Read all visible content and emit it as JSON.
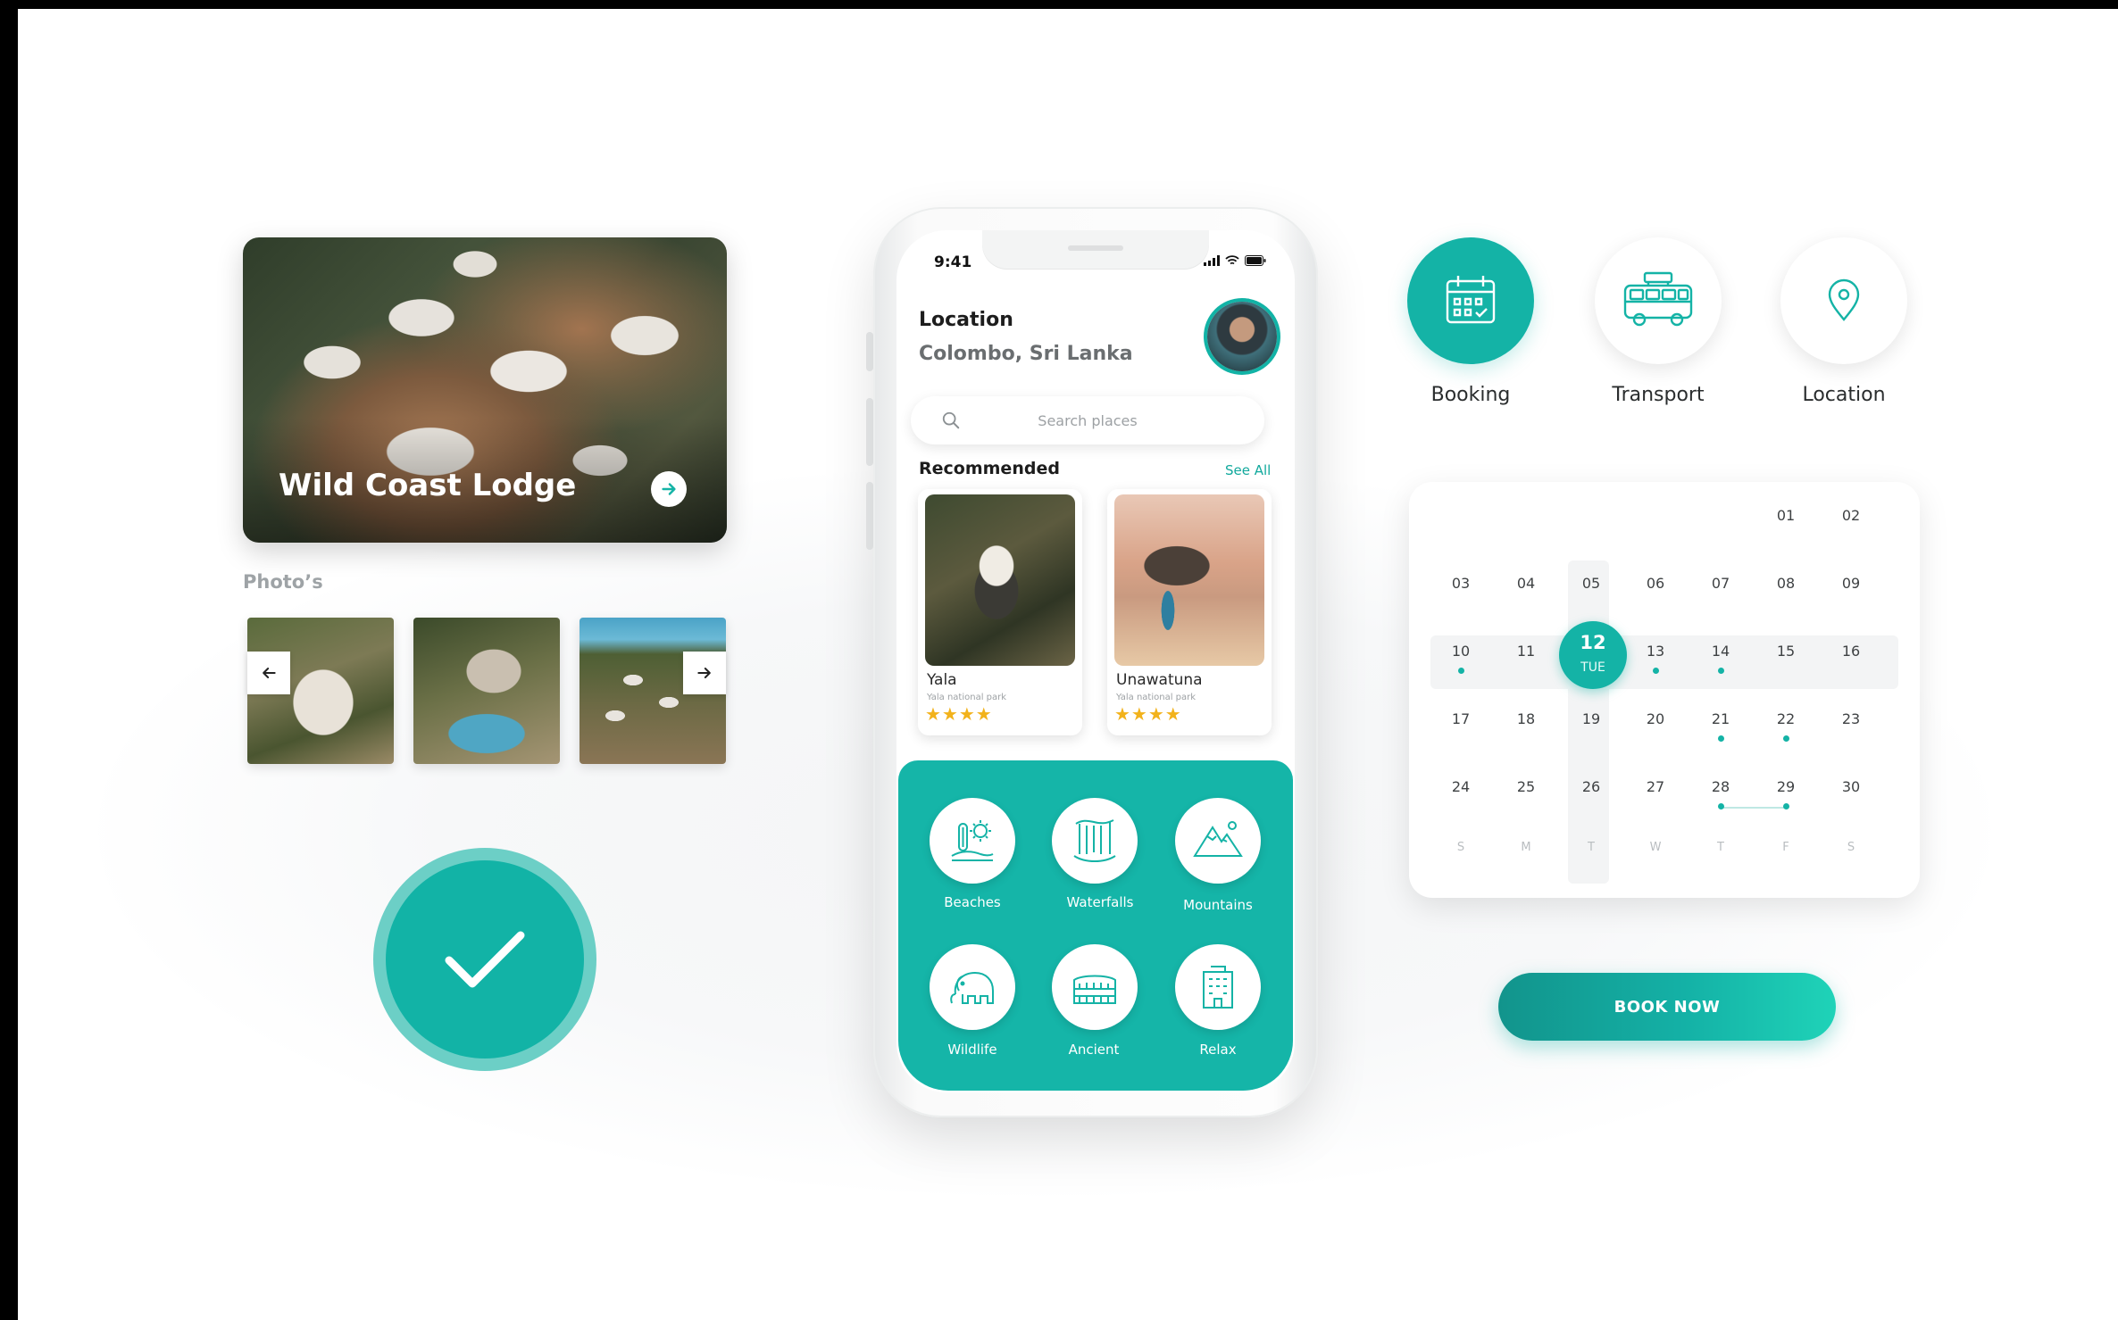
{
  "lodge": {
    "title": "Wild Coast Lodge"
  },
  "photos": {
    "label": "Photo’s"
  },
  "phone": {
    "time": "9:41",
    "location_label": "Location",
    "location_value": "Colombo, Sri Lanka",
    "search_placeholder": "Search places",
    "recommended_label": "Recommended",
    "see_all": "See All",
    "recommended": [
      {
        "name": "Yala",
        "sub": "Yala national park",
        "stars": "★★★★"
      },
      {
        "name": "Unawatuna",
        "sub": "Yala national park",
        "stars": "★★★★"
      }
    ],
    "categories": [
      "Beaches",
      "Waterfalls",
      "Mountains",
      "Wildlife",
      "Ancient",
      "Relax"
    ]
  },
  "features": [
    "Booking",
    "Transport",
    "Location"
  ],
  "calendar": {
    "rows": [
      [
        "",
        "",
        "",
        "",
        "",
        "01",
        "02"
      ],
      [
        "03",
        "04",
        "05",
        "06",
        "07",
        "08",
        "09"
      ],
      [
        "10",
        "11",
        "12",
        "13",
        "14",
        "15",
        "16"
      ],
      [
        "17",
        "18",
        "19",
        "20",
        "21",
        "22",
        "23"
      ],
      [
        "24",
        "25",
        "26",
        "27",
        "28",
        "29",
        "30"
      ]
    ],
    "weekdays": [
      "S",
      "M",
      "T",
      "W",
      "T",
      "F",
      "S"
    ],
    "selected_day": "12",
    "selected_weekday": "TUE"
  },
  "book_now": "BOOK NOW",
  "colors": {
    "accent": "#14b3a6",
    "star": "#f2b21b"
  }
}
